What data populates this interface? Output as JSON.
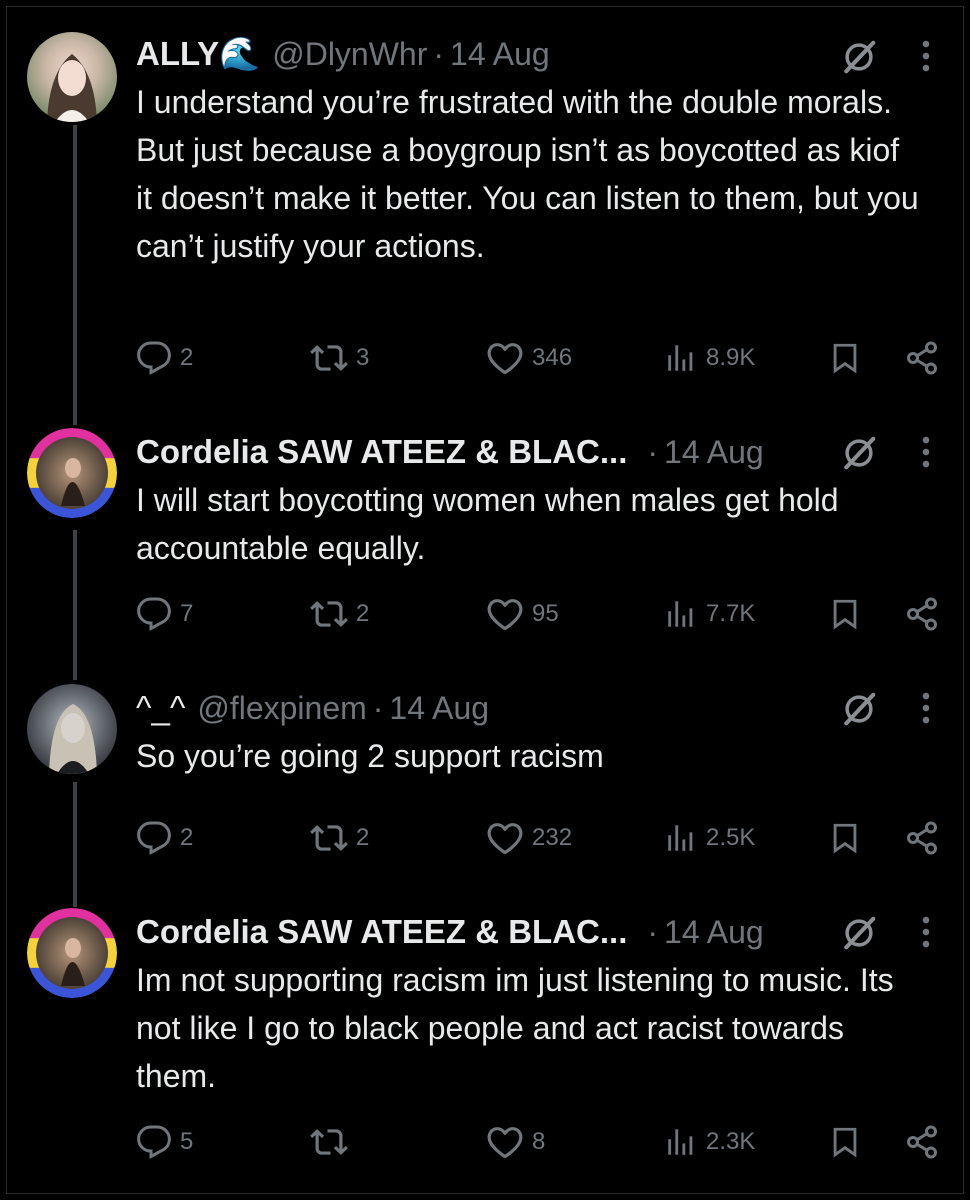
{
  "tweets": [
    {
      "name": "ALLY🌊",
      "handle": "@DlynWhr",
      "separator": "·",
      "date": "14 Aug",
      "text": "I understand you’re frustrated with the double morals. But just because a boygroup isn’t as boycotted as kiof it doesn’t make it better. You can listen to them, but you can’t justify your actions.",
      "replies": "2",
      "reposts": "3",
      "likes": "346",
      "views": "8.9K"
    },
    {
      "name": "Cordelia SAW ATEEZ & BLAC...",
      "handle": "",
      "separator": "·",
      "date": "14 Aug",
      "text": "I will start boycotting women when males get hold accountable equally.",
      "replies": "7",
      "reposts": "2",
      "likes": "95",
      "views": "7.7K"
    },
    {
      "name": "^_^",
      "handle": "@flexpinem",
      "separator": "·",
      "date": "14 Aug",
      "text": "So you’re going 2 support racism",
      "replies": "2",
      "reposts": "2",
      "likes": "232",
      "views": "2.5K"
    },
    {
      "name": "Cordelia SAW ATEEZ & BLAC...",
      "handle": "",
      "separator": "·",
      "date": "14 Aug",
      "text": "Im not supporting racism im just listening to music. Its not like I go to black people and act racist towards them.",
      "replies": "5",
      "reposts": "",
      "likes": "8",
      "views": "2.3K"
    }
  ],
  "icons": {
    "reply": "reply-icon",
    "repost": "repost-icon",
    "like": "heart-icon",
    "views": "views-icon",
    "bookmark": "bookmark-icon",
    "share": "share-icon",
    "grok": "grok-icon",
    "more": "more-icon"
  },
  "colors": {
    "background": "#000000",
    "text": "#e7e9ea",
    "muted": "#71767b",
    "thread_line": "#3e4144",
    "ring_pink": "#e0319e",
    "ring_yellow": "#f4d33a",
    "ring_blue": "#3b55d9"
  }
}
